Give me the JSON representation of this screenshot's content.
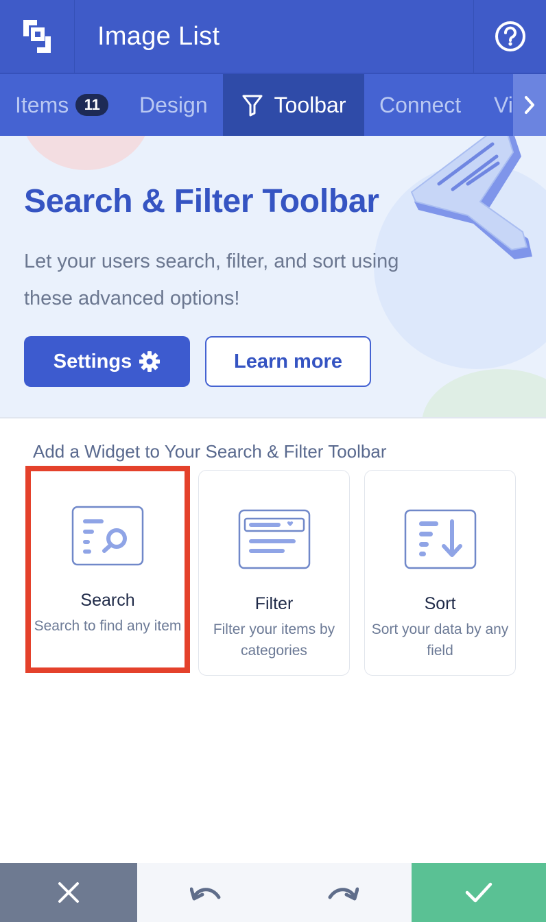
{
  "header": {
    "title": "Image List",
    "logo_icon": "app-logo-icon",
    "help_icon": "question-circle-icon"
  },
  "tabs": [
    {
      "label": "Items",
      "badge": "11",
      "active": false
    },
    {
      "label": "Design",
      "active": false
    },
    {
      "label": "Toolbar",
      "icon": "funnel-icon",
      "active": true
    },
    {
      "label": "Connect",
      "active": false
    },
    {
      "label": "Vi",
      "active": false
    }
  ],
  "tabs_next_icon": "chevron-right-icon",
  "hero": {
    "title": "Search & Filter Toolbar",
    "description": "Let your users search, filter, and sort using these advanced options!",
    "settings_label": "Settings",
    "settings_icon": "gear-icon",
    "learn_more_label": "Learn more"
  },
  "widgets": {
    "section_title": "Add a Widget to Your Search & Filter Toolbar",
    "items": [
      {
        "title": "Search",
        "description": "Search to find any item",
        "icon": "search-widget-icon",
        "selected": true
      },
      {
        "title": "Filter",
        "description": "Filter your items by categories",
        "icon": "filter-widget-icon",
        "selected": false
      },
      {
        "title": "Sort",
        "description": "Sort your data by any field",
        "icon": "sort-widget-icon",
        "selected": false
      }
    ]
  },
  "bottom_bar": {
    "cancel_icon": "close-icon",
    "undo_icon": "undo-icon",
    "redo_icon": "redo-icon",
    "confirm_icon": "check-icon"
  },
  "colors": {
    "header": "#3f5bc8",
    "accent": "#3d5bcf",
    "highlight": "#e4412b",
    "confirm": "#5ac194",
    "cancel": "#6e7a91"
  }
}
